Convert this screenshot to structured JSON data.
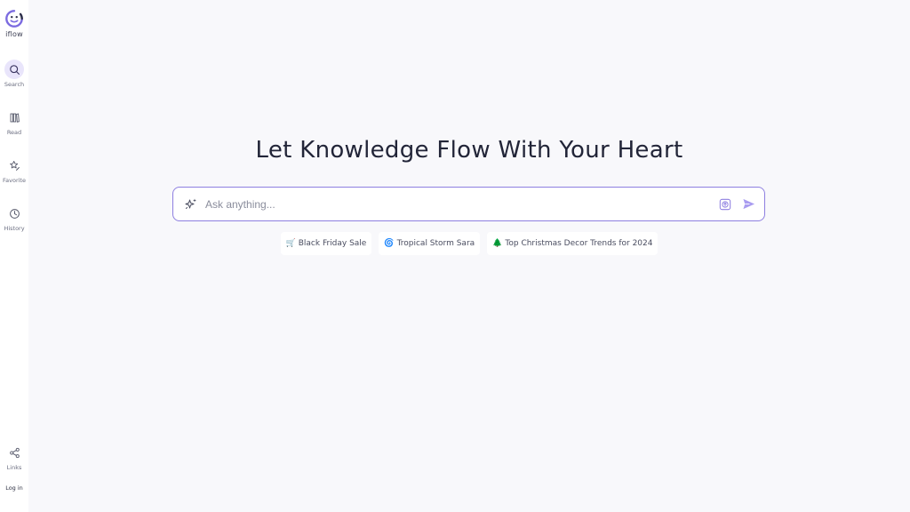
{
  "app": {
    "name": "iflow"
  },
  "sidebar": {
    "items": [
      {
        "label": "Search",
        "icon": "search-icon",
        "active": true
      },
      {
        "label": "Read",
        "icon": "books-icon",
        "active": false
      },
      {
        "label": "Favorite",
        "icon": "star-edit-icon",
        "active": false
      },
      {
        "label": "History",
        "icon": "clock-icon",
        "active": false
      }
    ],
    "links_label": "Links",
    "login_label": "Log in"
  },
  "main": {
    "headline": "Let Knowledge Flow With Your Heart",
    "search": {
      "placeholder": "Ask anything...",
      "value": ""
    },
    "suggestions": [
      {
        "emoji": "🛒",
        "label": "Black Friday Sale"
      },
      {
        "emoji": "🌀",
        "label": "Tropical Storm Sara"
      },
      {
        "emoji": "🌲",
        "label": "Top Christmas Decor Trends for 2024"
      }
    ]
  },
  "colors": {
    "accent": "#7b6be0",
    "accent_light": "#e9e5fb",
    "background": "#f8f8fb"
  }
}
